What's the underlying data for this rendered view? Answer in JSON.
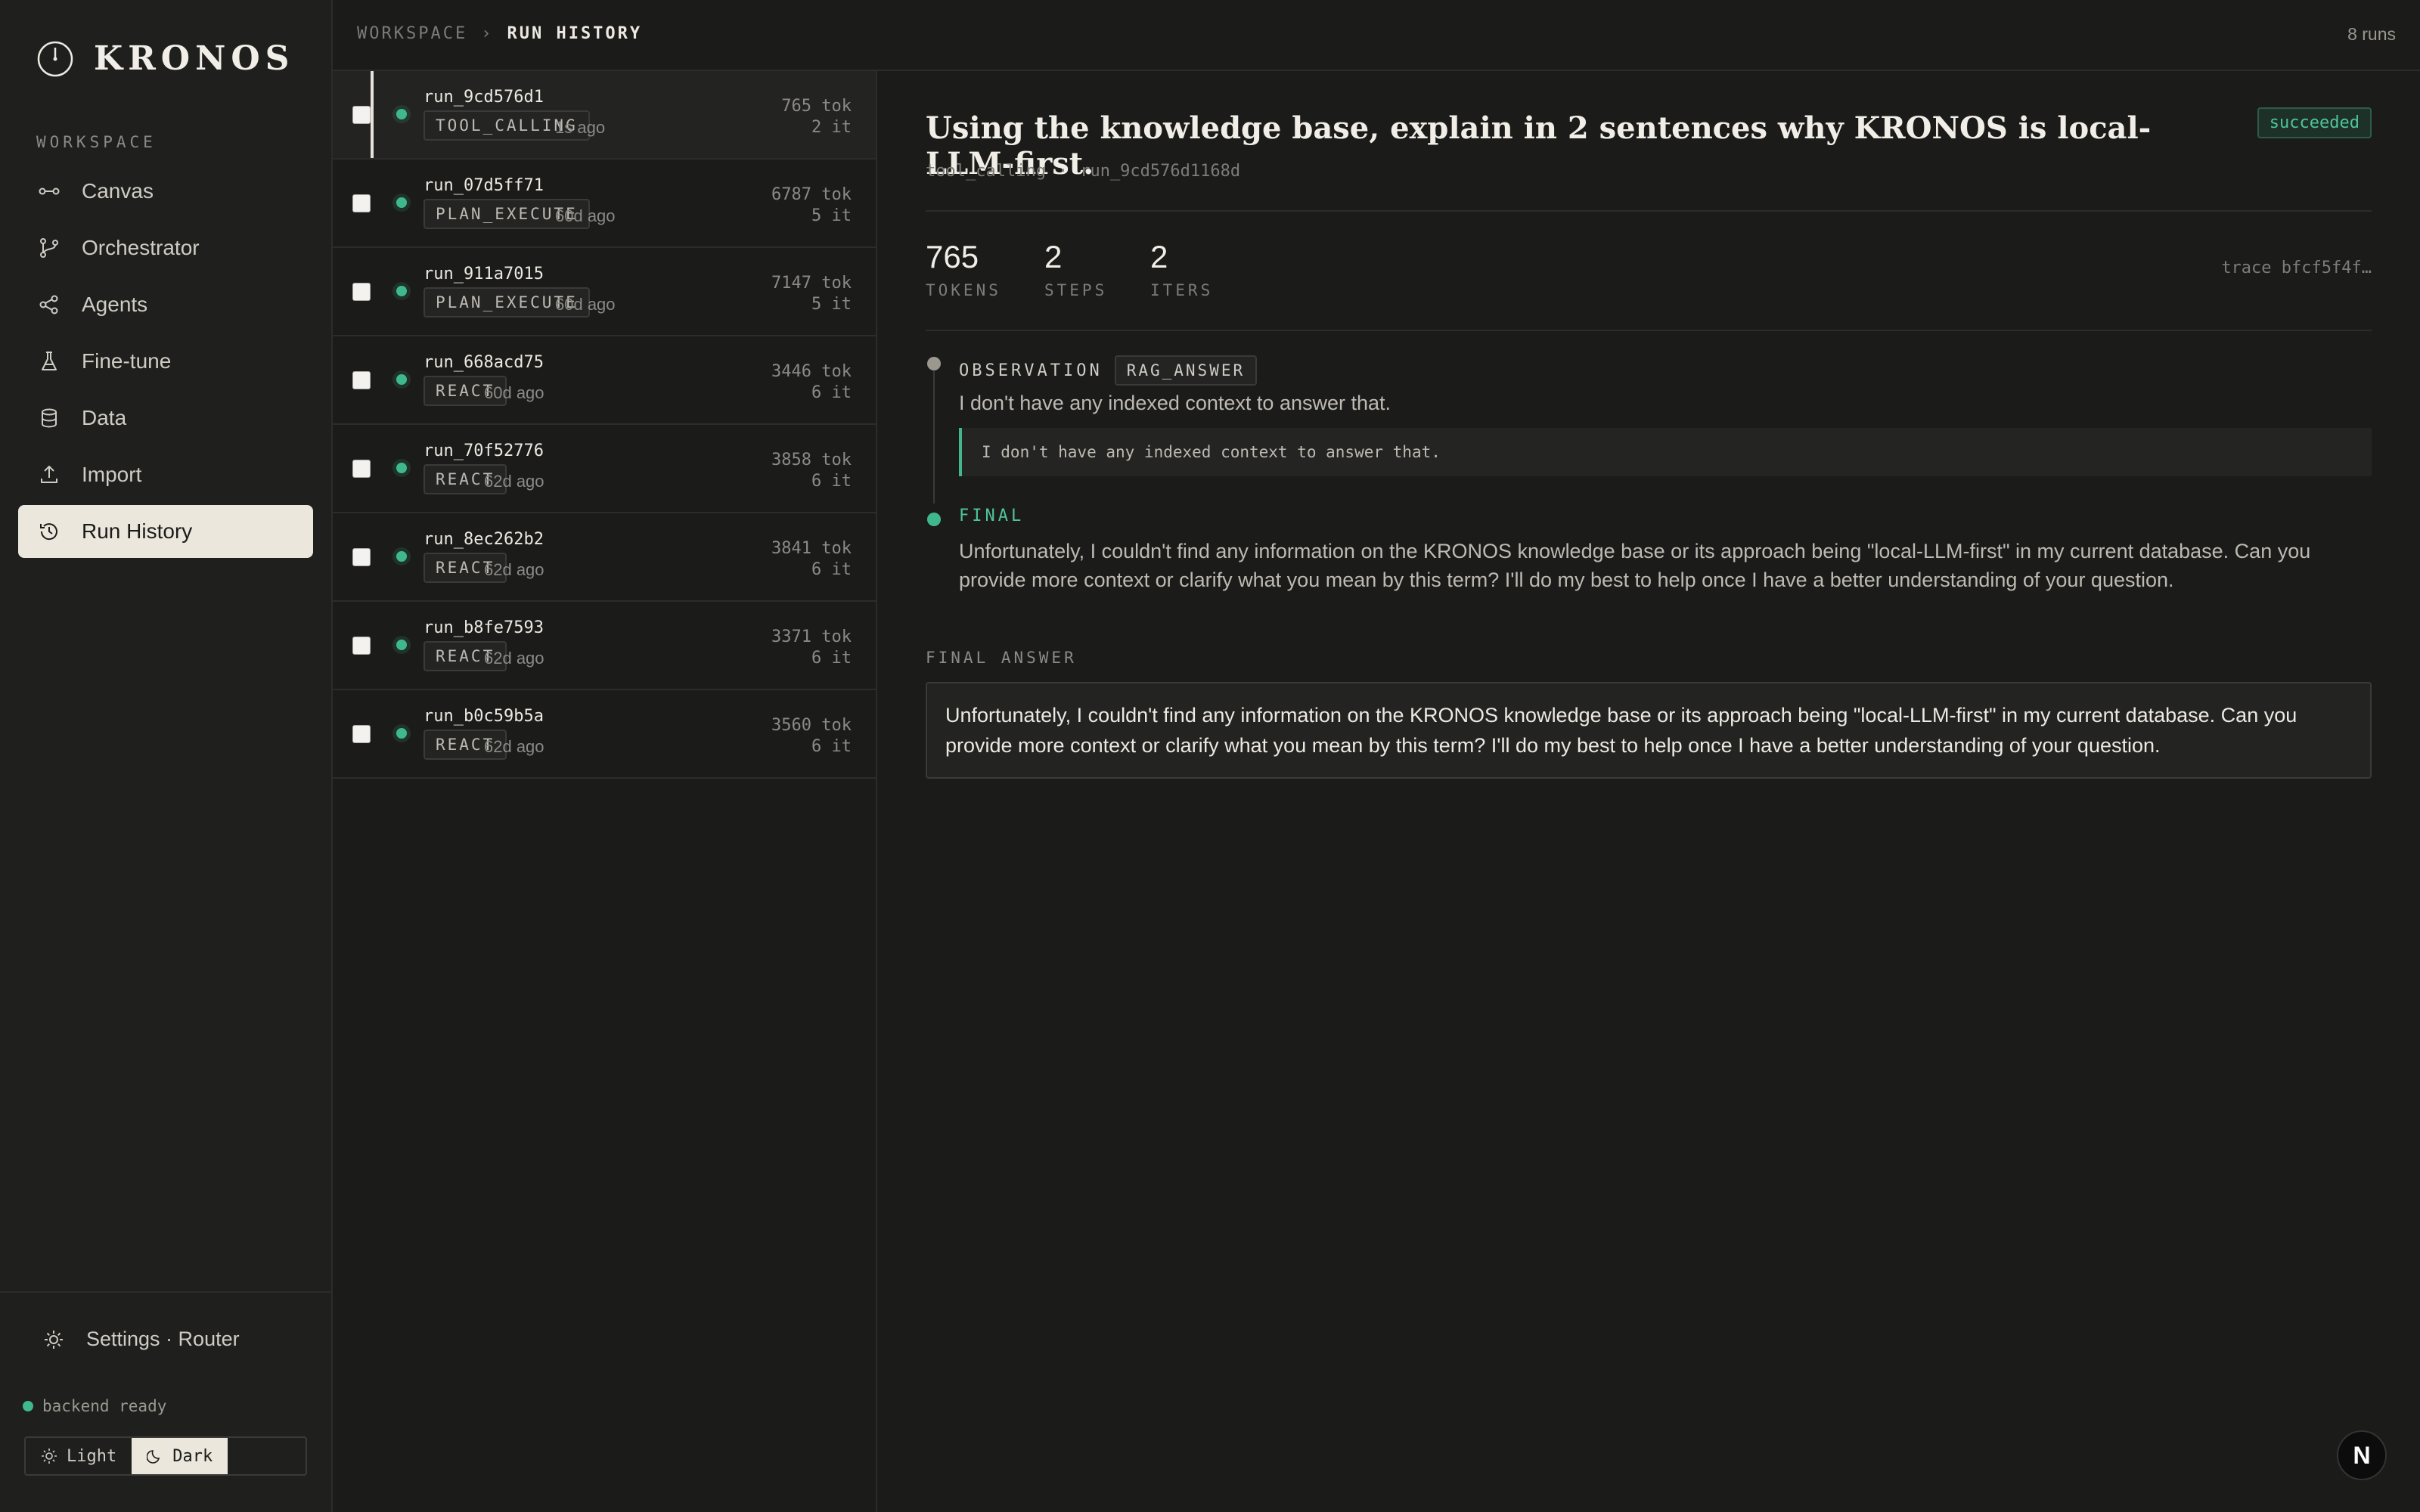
{
  "brand": {
    "name": "KRONOS"
  },
  "sidebar": {
    "section_label": "WORKSPACE",
    "items": [
      {
        "label": "Canvas",
        "icon": "canvas-icon"
      },
      {
        "label": "Orchestrator",
        "icon": "branch-icon"
      },
      {
        "label": "Agents",
        "icon": "agents-icon"
      },
      {
        "label": "Fine-tune",
        "icon": "flask-icon"
      },
      {
        "label": "Data",
        "icon": "database-icon"
      },
      {
        "label": "Import",
        "icon": "upload-icon"
      },
      {
        "label": "Run History",
        "icon": "history-icon",
        "active": true
      }
    ],
    "settings_label": "Settings · Router",
    "backend_status": "backend ready",
    "theme": {
      "light": "Light",
      "dark": "Dark",
      "selected": "Dark"
    }
  },
  "topbar": {
    "breadcrumb": [
      "WORKSPACE",
      "RUN HISTORY"
    ],
    "separator": "›",
    "runs_count": "8 runs"
  },
  "runs": [
    {
      "id": "run_9cd576d1",
      "type": "TOOL_CALLING",
      "age": "1s ago",
      "tokens": "765 tok",
      "iters": "2 it",
      "selected": true
    },
    {
      "id": "run_07d5ff71",
      "type": "PLAN_EXECUTE",
      "age": "60d ago",
      "tokens": "6787 tok",
      "iters": "5 it"
    },
    {
      "id": "run_911a7015",
      "type": "PLAN_EXECUTE",
      "age": "60d ago",
      "tokens": "7147 tok",
      "iters": "5 it"
    },
    {
      "id": "run_668acd75",
      "type": "REACT",
      "age": "60d ago",
      "tokens": "3446 tok",
      "iters": "6 it"
    },
    {
      "id": "run_70f52776",
      "type": "REACT",
      "age": "62d ago",
      "tokens": "3858 tok",
      "iters": "6 it"
    },
    {
      "id": "run_8ec262b2",
      "type": "REACT",
      "age": "62d ago",
      "tokens": "3841 tok",
      "iters": "6 it"
    },
    {
      "id": "run_b8fe7593",
      "type": "REACT",
      "age": "62d ago",
      "tokens": "3371 tok",
      "iters": "6 it"
    },
    {
      "id": "run_b0c59b5a",
      "type": "REACT",
      "age": "62d ago",
      "tokens": "3560 tok",
      "iters": "6 it"
    }
  ],
  "detail": {
    "title": "Using the knowledge base, explain in 2 sentences why KRONOS is local-LLM-first.",
    "status": "succeeded",
    "sub_type": "tool_calling",
    "sub_sep": "·",
    "sub_id": "run_9cd576d1168d",
    "stats": [
      {
        "value": "765",
        "label": "TOKENS"
      },
      {
        "value": "2",
        "label": "STEPS"
      },
      {
        "value": "2",
        "label": "ITERS"
      }
    ],
    "trace": "trace bfcf5f4f…",
    "observation": {
      "label": "OBSERVATION",
      "tag": "RAG_ANSWER",
      "text": "I don't have any indexed context to answer that.",
      "quote": "I don't have any indexed context to answer that."
    },
    "final": {
      "label": "FINAL",
      "text": "Unfortunately, I couldn't find any information on the KRONOS knowledge base or its approach being \"local-LLM-first\" in my current database. Can you provide more context or clarify what you mean by this term? I'll do my best to help once I have a better understanding of your question."
    },
    "final_answer_label": "FINAL ANSWER",
    "final_answer": "Unfortunately, I couldn't find any information on the KRONOS knowledge base or its approach being \"local-LLM-first\" in my current database. Can you provide more context or clarify what you mean by this term? I'll do my best to help once I have a better understanding of your question."
  },
  "overlay_badge": "N",
  "colors": {
    "accent": "#3fb98b",
    "bg": "#1b1b1a",
    "sidebar_bg": "#1f1f1e",
    "active_bg": "#ebe7dd"
  }
}
